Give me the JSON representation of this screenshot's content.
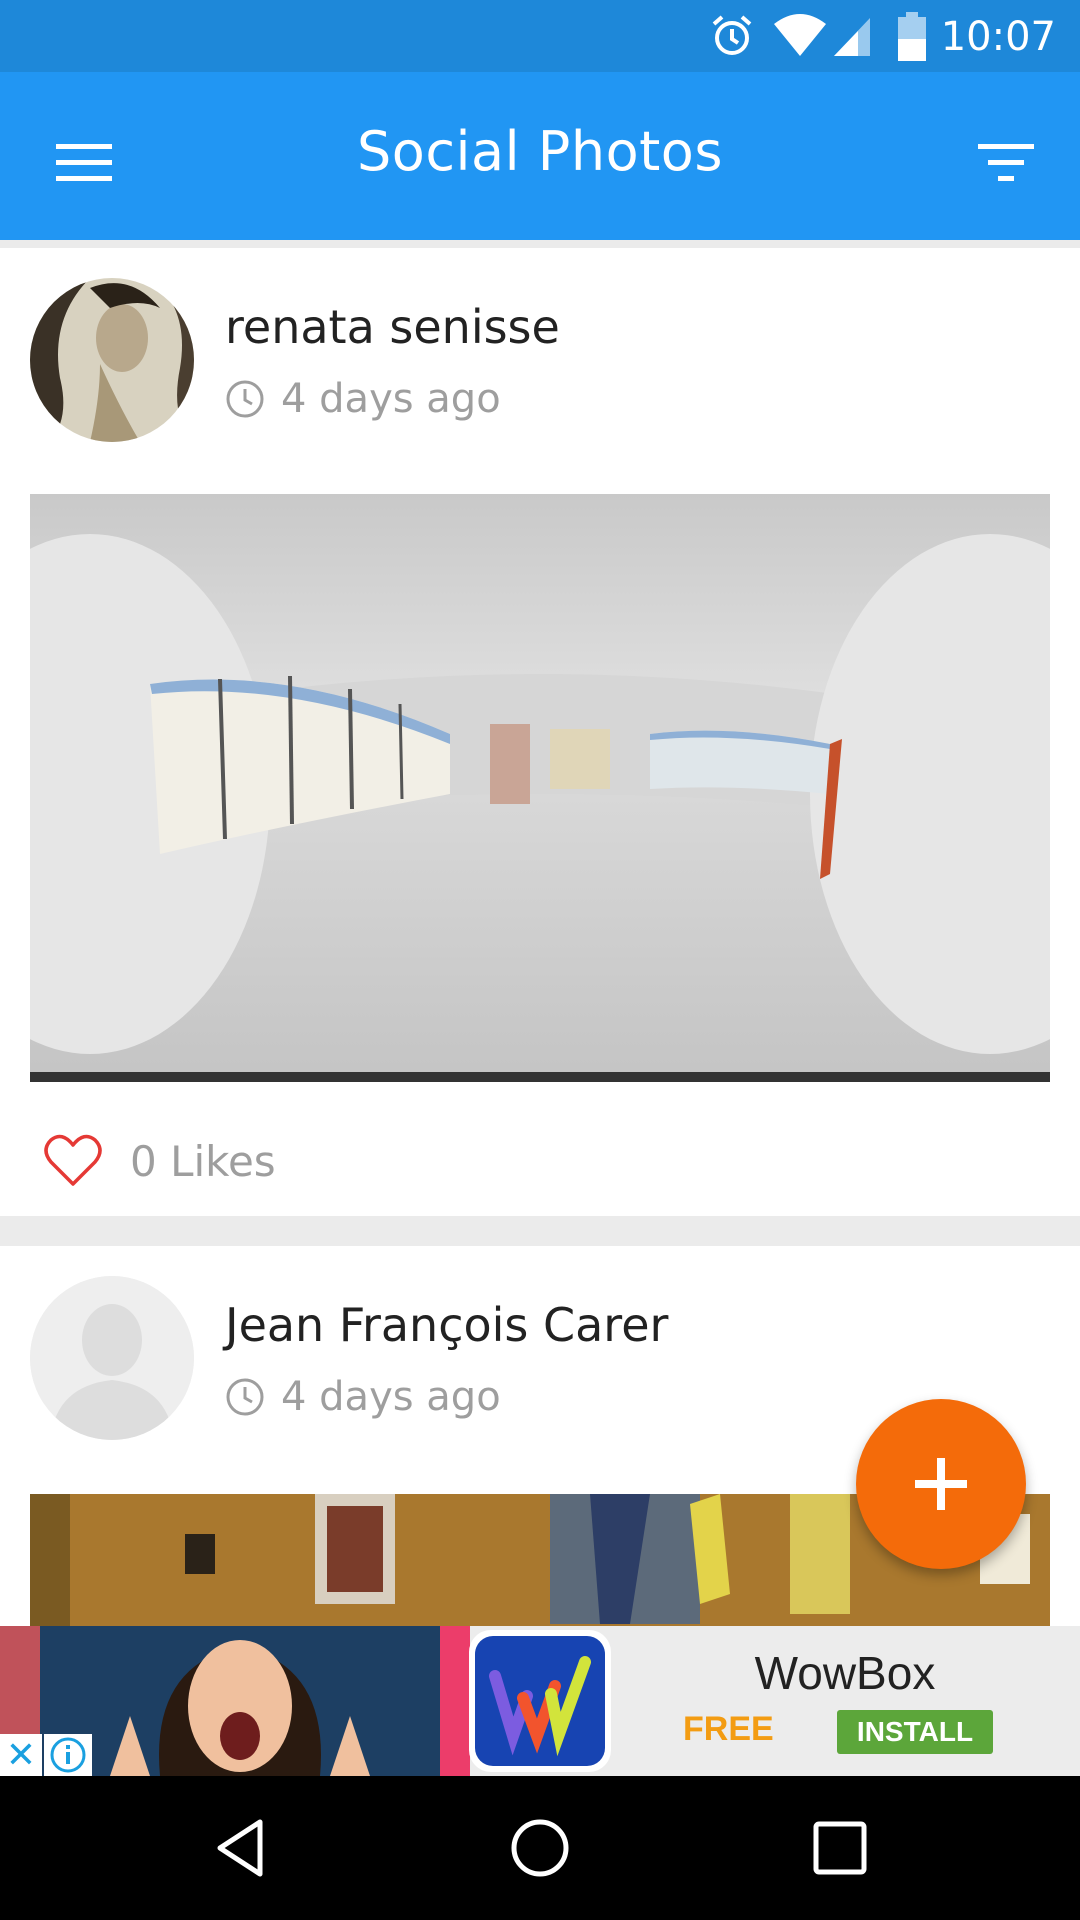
{
  "status_bar": {
    "time": "10:07",
    "icons": [
      "alarm-icon",
      "wifi-icon",
      "signal-icon",
      "battery-icon"
    ]
  },
  "app_bar": {
    "title": "Social Photos",
    "menu_icon": "hamburger-menu-icon",
    "filter_icon": "filter-icon",
    "background": "#2196f3"
  },
  "feed": {
    "posts": [
      {
        "user_name": "renata senisse",
        "time": "4 days ago",
        "likes": "0 Likes",
        "photo": "360-room-panorama"
      },
      {
        "user_name": "Jean François Carer",
        "time": "4 days ago",
        "photo": "indoor-flags-photo"
      }
    ]
  },
  "fab": {
    "icon": "plus-icon",
    "color": "#f46b0a"
  },
  "ad": {
    "brand": "WowBox",
    "price": "FREE",
    "cta": "INSTALL"
  },
  "nav_bar": {
    "icons": [
      "back-icon",
      "home-icon",
      "recents-icon"
    ]
  }
}
